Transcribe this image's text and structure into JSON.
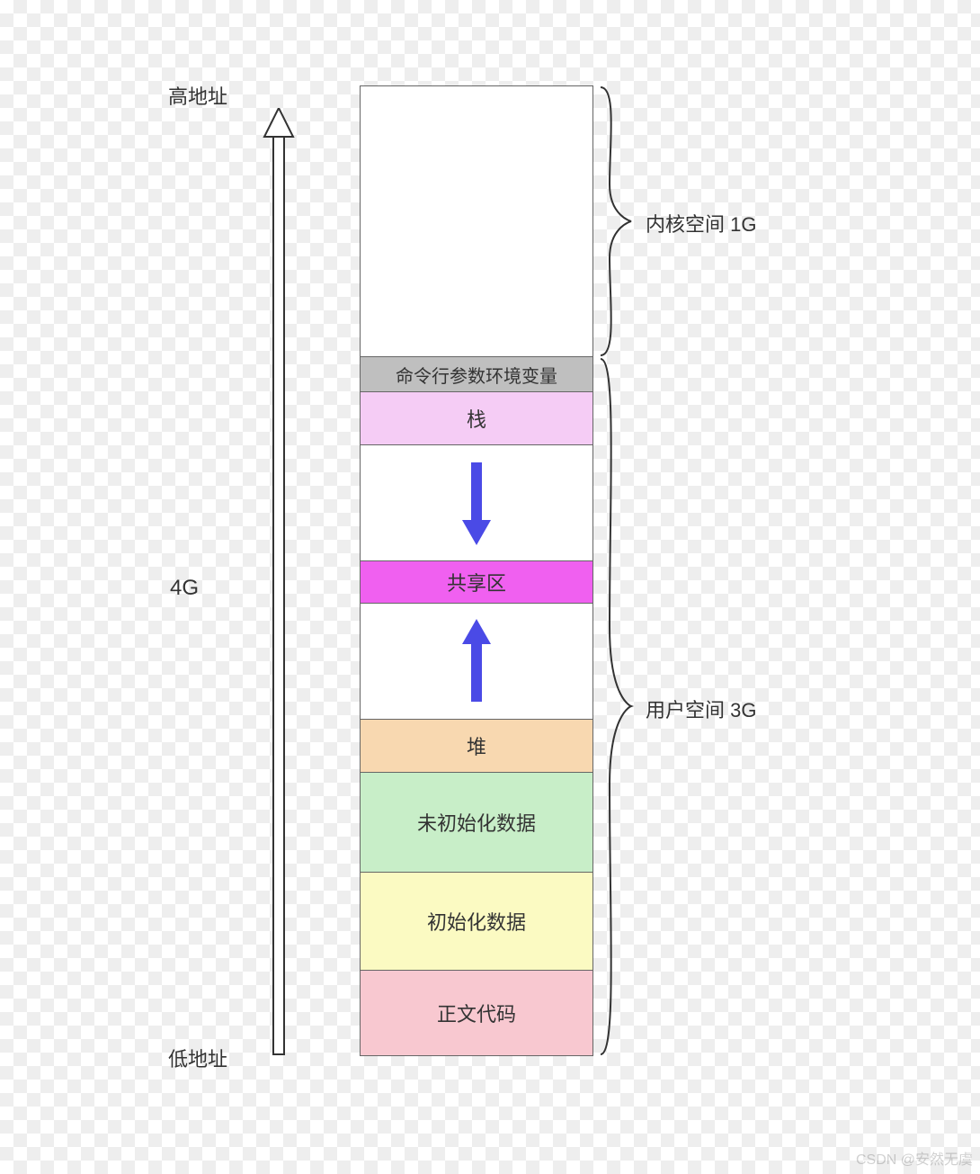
{
  "labels": {
    "high_addr": "高地址",
    "low_addr": "低地址",
    "total_size": "4G"
  },
  "segments": {
    "kernel": "",
    "cmdline_env": "命令行参数环境变量",
    "stack": "栈",
    "shared": "共享区",
    "heap": "堆",
    "bss": "未初始化数据",
    "data": "初始化数据",
    "text": "正文代码"
  },
  "space_labels": {
    "kernel": "内核空间 1G",
    "user": "用户空间 3G"
  },
  "watermark": "CSDN @安然无虞"
}
